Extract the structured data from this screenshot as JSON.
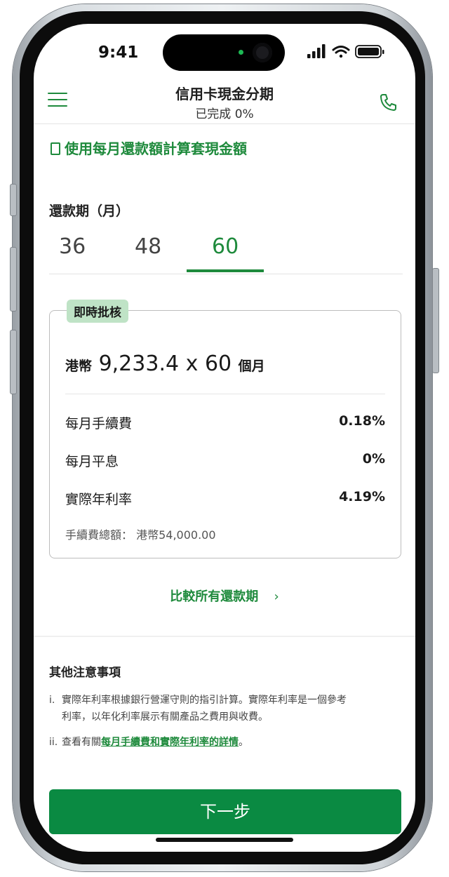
{
  "status_bar": {
    "time": "9:41"
  },
  "header": {
    "title": "信用卡現金分期",
    "subtitle": "已完成 0%"
  },
  "section": {
    "heading": "使用每月還款額計算套現金額"
  },
  "period": {
    "label": "還款期（月）",
    "options": [
      "36",
      "48",
      "60"
    ],
    "selected": "60"
  },
  "offer": {
    "badge": "即時批核",
    "currency": "港幣",
    "monthly_amount": "9,233.4",
    "times": "x",
    "months": "60",
    "months_unit": "個月",
    "rows": [
      {
        "label": "每月手續費",
        "value": "0.18%"
      },
      {
        "label": "每月平息",
        "value": "0%"
      },
      {
        "label": "實際年利率",
        "value": "4.19%"
      }
    ],
    "fee_total_label": "手續費總額：",
    "fee_total_value": "港幣54,000.00"
  },
  "compare": {
    "label": "比較所有還款期",
    "chevron": "›"
  },
  "notes": {
    "title": "其他注意事項",
    "item1_num": "i.",
    "item1_line1": "實際年利率根據銀行營運守則的指引計算。實際年利率是一個參考",
    "item1_line2": "利率，以年化利率展示有關產品之費用與收費。",
    "item2_num": "ii.",
    "item2_prefix": "查看有關",
    "item2_link": "每月手續費和實際年利率的詳情",
    "item2_suffix": "。"
  },
  "footer": {
    "next_label": "下一步"
  },
  "colors": {
    "brand_green": "#1e8a3c",
    "button_green": "#0a8a42",
    "badge_bg": "#bfe3c6"
  }
}
